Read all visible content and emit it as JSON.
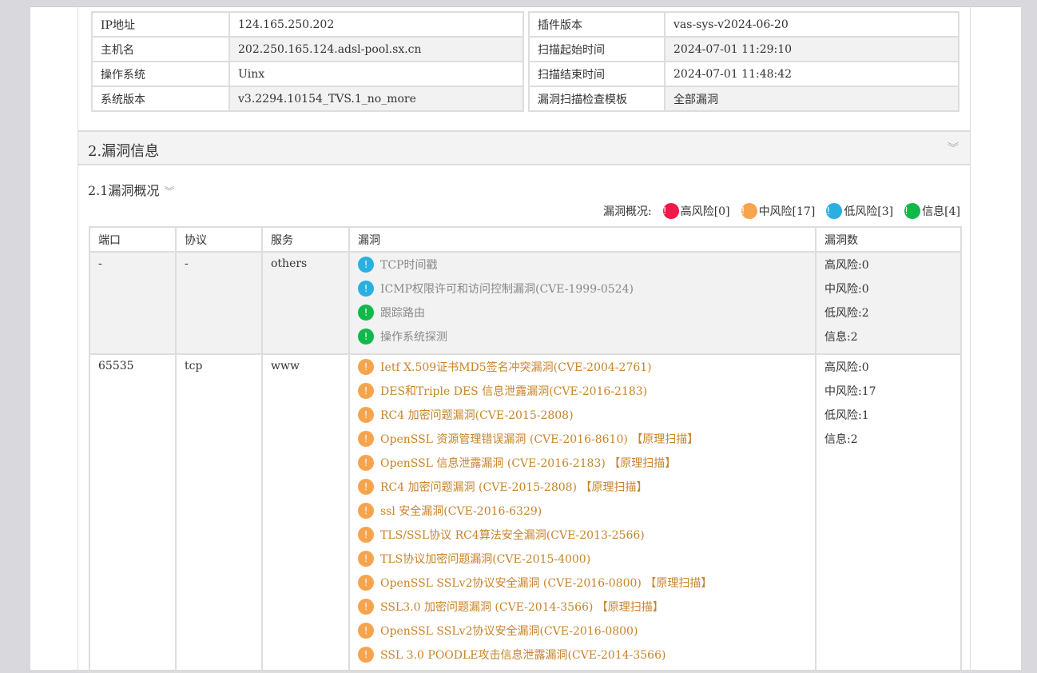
{
  "info_left": [
    [
      "IP地址",
      "124.165.250.202"
    ],
    [
      "主机名",
      "202.250.165.124.adsl-pool.sx.cn"
    ],
    [
      "操作系统",
      "Uinx"
    ],
    [
      "系统版本",
      "v3.2294.10154_TVS.1_no_more"
    ]
  ],
  "info_right": [
    [
      "插件版本",
      "vas-sys-v2024-06-20"
    ],
    [
      "扫描起始时间",
      "2024-07-01 11:29:10"
    ],
    [
      "扫描结束时间",
      "2024-07-01 11:48:42"
    ],
    [
      "漏洞扫描检查模板",
      "全部漏洞"
    ]
  ],
  "section": {
    "title": "2.漏洞信息",
    "chevron": "︾"
  },
  "subsection": {
    "title": "2.1漏洞概况",
    "chevron": "︾"
  },
  "legend": {
    "label": "漏洞概况:",
    "items": [
      {
        "text": "高风险[0]",
        "color": "#f0194a"
      },
      {
        "text": "中风险[17]",
        "color": "#f6a54e"
      },
      {
        "text": "低风险[3]",
        "color": "#2ab0e0"
      },
      {
        "text": "信息[4]",
        "color": "#10b94a"
      }
    ]
  },
  "table": {
    "headers": [
      "端口",
      "协议",
      "服务",
      "漏洞",
      "漏洞数"
    ],
    "groups": [
      {
        "port": "-",
        "proto": "-",
        "service": "others",
        "counts": [
          "高风险:0",
          "中风险:0",
          "低风险:2",
          "信息:2"
        ],
        "vulns": [
          {
            "level": "low",
            "text": "TCP时间戳"
          },
          {
            "level": "low",
            "text": "ICMP权限许可和访问控制漏洞(CVE-1999-0524)"
          },
          {
            "level": "info",
            "text": "跟踪路由"
          },
          {
            "level": "info",
            "text": "操作系统探测"
          }
        ]
      },
      {
        "port": "65535",
        "proto": "tcp",
        "service": "www",
        "counts": [
          "高风险:0",
          "中风险:17",
          "低风险:1",
          "信息:2"
        ],
        "vulns": [
          {
            "level": "mid",
            "text": "Ietf X.509证书MD5签名冲突漏洞(CVE-2004-2761)"
          },
          {
            "level": "mid",
            "text": "DES和Triple DES 信息泄露漏洞(CVE-2016-2183)"
          },
          {
            "level": "mid",
            "text": "RC4 加密问题漏洞(CVE-2015-2808)"
          },
          {
            "level": "mid",
            "text": "OpenSSL 资源管理错误漏洞 (CVE-2016-8610) 【原理扫描】"
          },
          {
            "level": "mid",
            "text": "OpenSSL 信息泄露漏洞 (CVE-2016-2183) 【原理扫描】"
          },
          {
            "level": "mid",
            "text": "RC4 加密问题漏洞 (CVE-2015-2808) 【原理扫描】"
          },
          {
            "level": "mid",
            "text": "ssl 安全漏洞(CVE-2016-6329)"
          },
          {
            "level": "mid",
            "text": "TLS/SSL协议 RC4算法安全漏洞(CVE-2013-2566)"
          },
          {
            "level": "mid",
            "text": "TLS协议加密问题漏洞(CVE-2015-4000)"
          },
          {
            "level": "mid",
            "text": "OpenSSL SSLv2协议安全漏洞 (CVE-2016-0800) 【原理扫描】"
          },
          {
            "level": "mid",
            "text": "SSL3.0 加密问题漏洞 (CVE-2014-3566) 【原理扫描】"
          },
          {
            "level": "mid",
            "text": "OpenSSL SSLv2协议安全漏洞(CVE-2016-0800)"
          },
          {
            "level": "mid",
            "text": "SSL 3.0 POODLE攻击信息泄露漏洞(CVE-2014-3566)"
          }
        ]
      }
    ]
  },
  "colors": {
    "low": "#2ab0e0",
    "mid": "#f6a54e",
    "info": "#10b94a",
    "high": "#f0194a"
  }
}
